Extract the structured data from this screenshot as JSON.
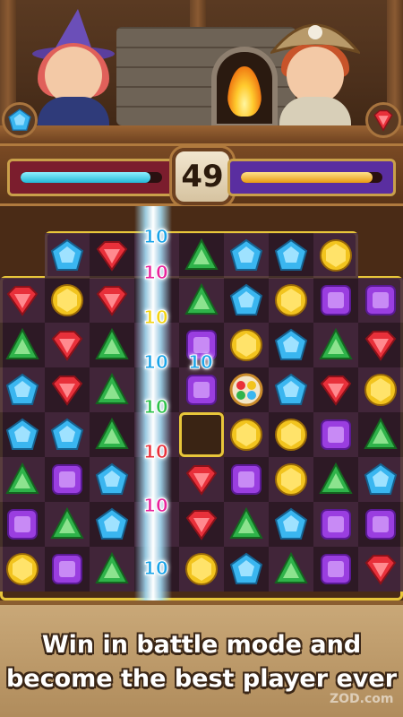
{
  "battle": {
    "moves_left": "49",
    "player_hp": 0.92,
    "enemy_hp": 0.93,
    "player_gem": "blue-gem",
    "enemy_gem": "red-gem"
  },
  "board": {
    "rows": [
      [
        "empty",
        "blue",
        "red",
        "",
        "green",
        "blue",
        "blue",
        "yellow",
        "empty"
      ],
      [
        "red",
        "yellow",
        "red",
        "",
        "green",
        "blue",
        "yellow",
        "purple",
        "purple"
      ],
      [
        "green",
        "red",
        "green",
        "",
        "purple",
        "yellow",
        "blue",
        "green",
        "red"
      ],
      [
        "blue",
        "red",
        "green",
        "",
        "purple",
        "rainbow",
        "blue",
        "red",
        "yellow"
      ],
      [
        "blue",
        "blue",
        "green",
        "",
        "hole",
        "yellow",
        "yellow",
        "purple",
        "green"
      ],
      [
        "green",
        "purple",
        "blue",
        "",
        "red",
        "purple",
        "yellow",
        "green",
        "blue"
      ],
      [
        "purple",
        "green",
        "blue",
        "",
        "red",
        "green",
        "blue",
        "purple",
        "purple"
      ],
      [
        "yellow",
        "purple",
        "green",
        "",
        "yellow",
        "blue",
        "green",
        "purple",
        "red"
      ]
    ],
    "score_pops": [
      {
        "text": "10",
        "color": "#1aa4e8"
      },
      {
        "text": "10",
        "color": "#e8249c"
      },
      {
        "text": "10",
        "color": "#f2d414"
      },
      {
        "text": "10",
        "color": "#1aa4e8"
      },
      {
        "text": "10",
        "color": "#1aa4e8"
      },
      {
        "text": "10",
        "color": "#2ec24a"
      },
      {
        "text": "10",
        "color": "#e8303a"
      },
      {
        "text": "10",
        "color": "#e8249c"
      },
      {
        "text": "10",
        "color": "#1aa4e8"
      }
    ]
  },
  "footer": {
    "tagline_line1": "Win in battle mode and",
    "tagline_line2": "become the best player ever",
    "watermark": "ZOD.com"
  },
  "colors": {
    "blue": "#3ab6f0",
    "red": "#e8303a",
    "green": "#2fb34a",
    "yellow": "#f2c41e",
    "purple": "#9a3ee0",
    "frame": "#e8c63a"
  }
}
